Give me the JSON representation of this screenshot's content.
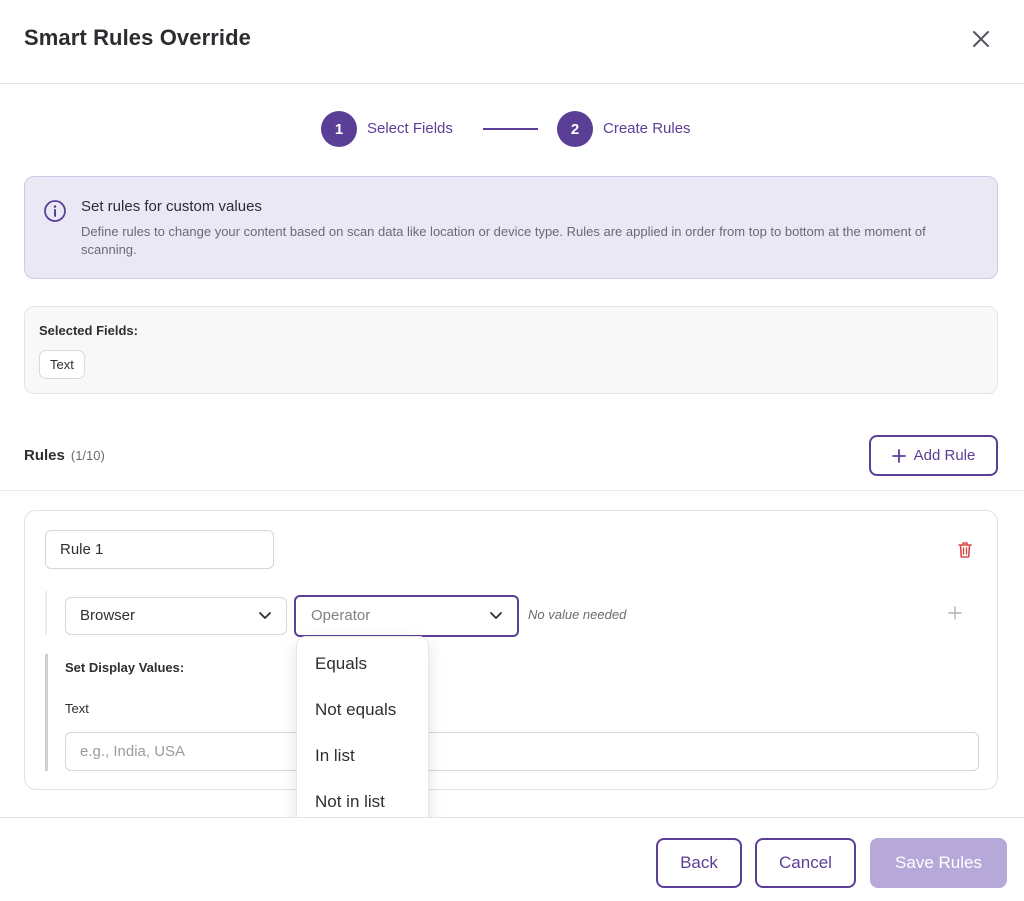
{
  "modal": {
    "title": "Smart Rules Override",
    "close_icon": "close-icon"
  },
  "stepper": {
    "steps": [
      {
        "number": "1",
        "label": "Select Fields"
      },
      {
        "number": "2",
        "label": "Create Rules"
      }
    ]
  },
  "info": {
    "icon": "info-icon",
    "title": "Set rules for custom values",
    "text": "Define rules to change your content based on scan data like location or device type. Rules are applied in order from top to bottom at the moment of scanning."
  },
  "selected_fields": {
    "label": "Selected Fields:",
    "chips": [
      "Text"
    ]
  },
  "rules": {
    "label": "Rules",
    "count": "(1/10)",
    "add_label": "Add Rule",
    "items": [
      {
        "name": "Rule 1",
        "condition": {
          "field": "Browser",
          "operator_placeholder": "Operator",
          "value_hint": "No value needed"
        },
        "display_values_label": "Set Display Values:",
        "text_label": "Text",
        "text_placeholder": "e.g., India, USA"
      }
    ]
  },
  "operator_dropdown": {
    "options": [
      "Equals",
      "Not equals",
      "In list",
      "Not in list"
    ]
  },
  "footer": {
    "back_label": "Back",
    "cancel_label": "Cancel",
    "save_label": "Save Rules"
  },
  "colors": {
    "accent": "#5b3f96",
    "info_bg": "#ebe8f6",
    "save_disabled": "#b6a8d8",
    "danger": "#d94a4a"
  }
}
